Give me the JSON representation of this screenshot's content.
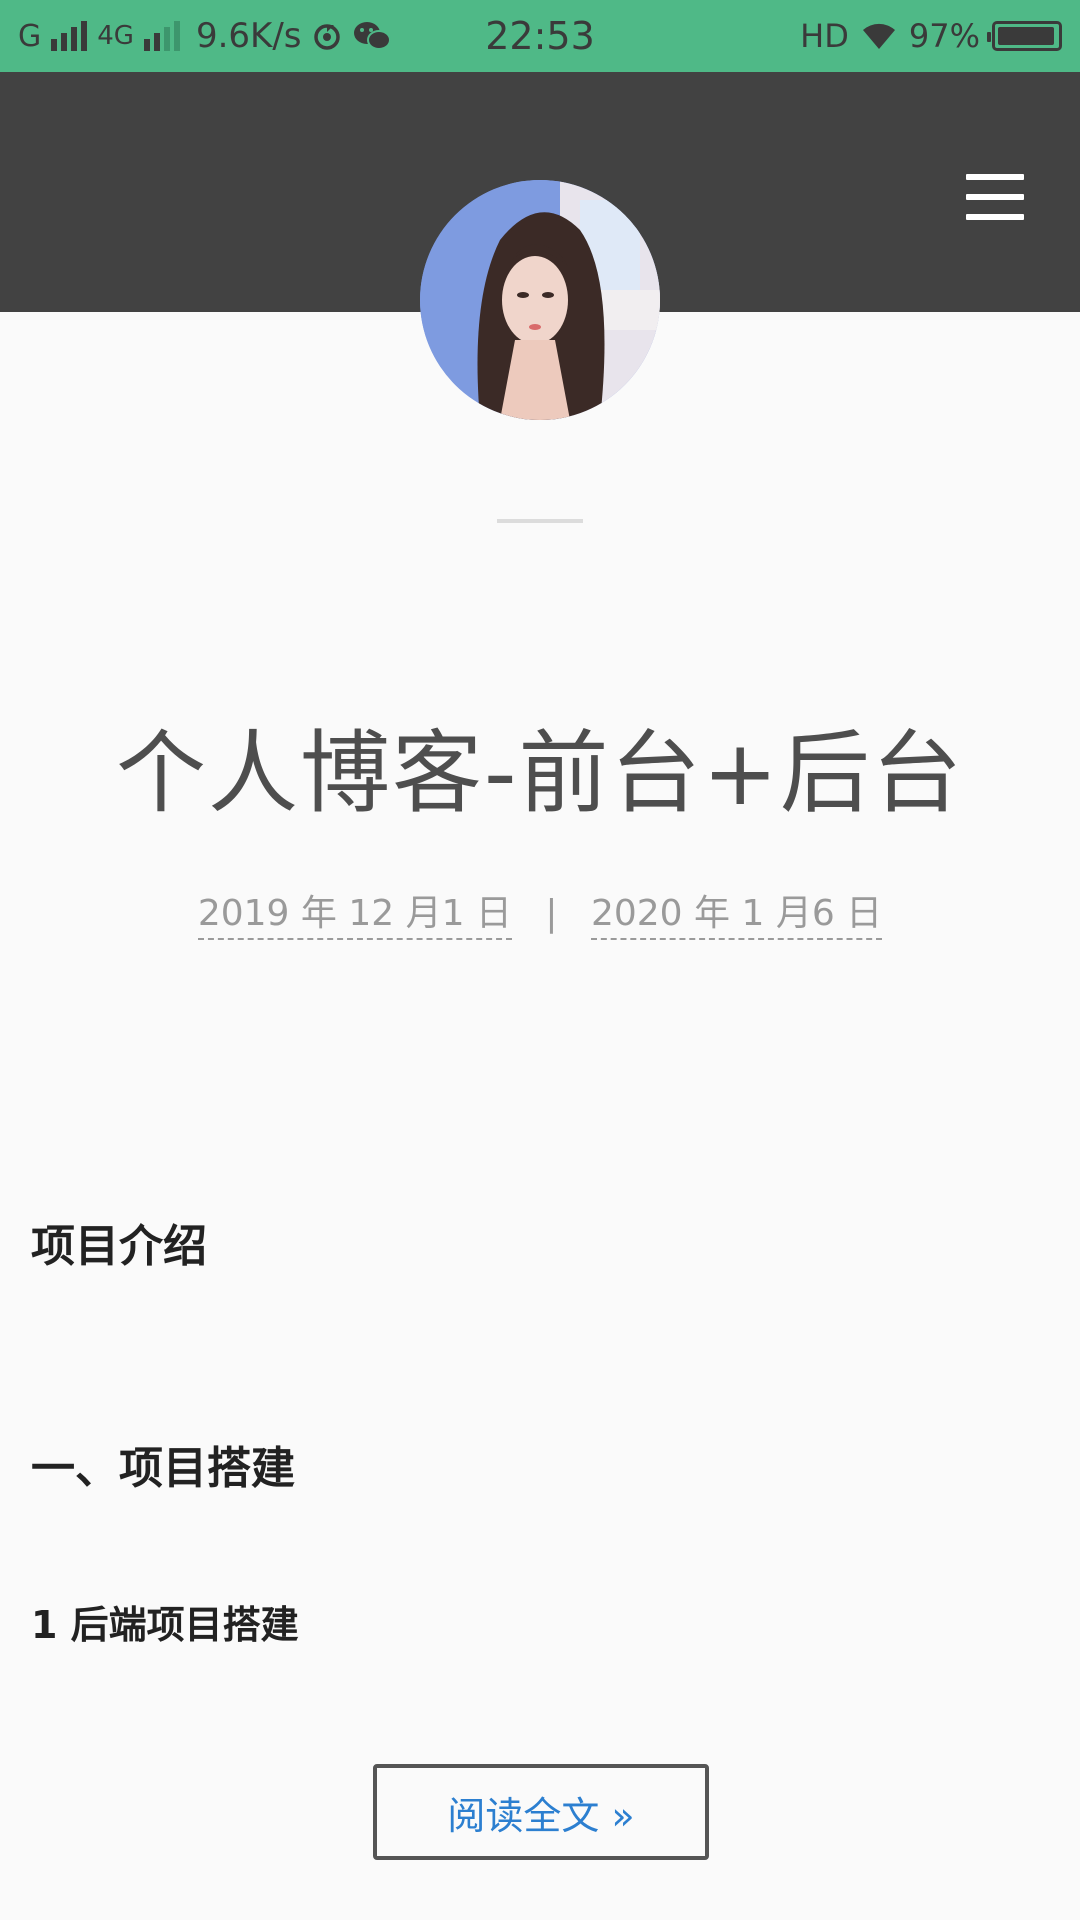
{
  "status_bar": {
    "carrier": "G",
    "network": "4G",
    "speed": "9.6K/s",
    "time": "22:53",
    "hd": "HD",
    "battery": "97%",
    "battery_level": 0.97,
    "icons": [
      "signal-icon",
      "signal-icon",
      "data-saver-icon",
      "wechat-icon",
      "wifi-icon",
      "battery-icon"
    ]
  },
  "header": {
    "menu_icon": "hamburger-menu-icon",
    "bg_color": "#424242"
  },
  "avatar": {
    "icon": "avatar-photo"
  },
  "post": {
    "title": "个人博客-前台+后台",
    "published_date": "2019 年 12 月1 日",
    "separator": "|",
    "updated_date": "2020 年 1 月6 日",
    "heading_intro": "项目介绍",
    "heading_build": "一、项目搭建",
    "heading_backend": "1 后端项目搭建",
    "read_more": "阅读全文 »"
  },
  "colors": {
    "status_bar": "#4fb987",
    "link": "#2c7fd0",
    "background": "#fafafa"
  }
}
